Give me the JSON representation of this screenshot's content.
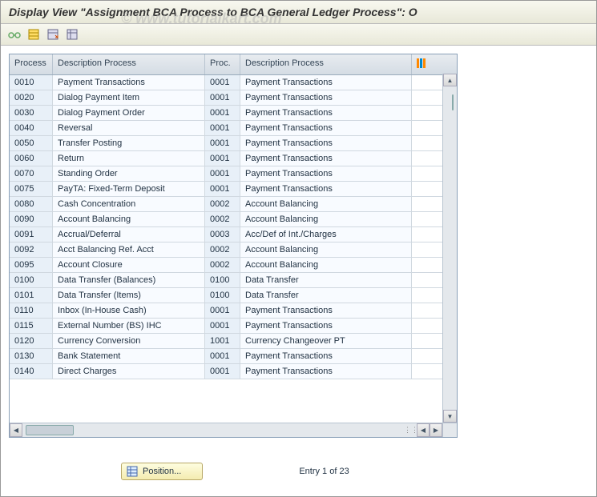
{
  "title": "Display View \"Assignment BCA Process to BCA General Ledger Process\": O",
  "watermark": "© www.tutorialkart.com",
  "toolbar": {
    "icons": [
      "glasses",
      "table-yellow",
      "table-export",
      "table-import"
    ]
  },
  "columns": {
    "process": "Process",
    "desc1": "Description Process",
    "proc": "Proc.",
    "desc2": "Description Process"
  },
  "rows": [
    {
      "process": "0010",
      "desc1": "Payment Transactions",
      "proc": "0001",
      "desc2": "Payment Transactions"
    },
    {
      "process": "0020",
      "desc1": "Dialog Payment Item",
      "proc": "0001",
      "desc2": "Payment Transactions"
    },
    {
      "process": "0030",
      "desc1": "Dialog Payment Order",
      "proc": "0001",
      "desc2": "Payment Transactions"
    },
    {
      "process": "0040",
      "desc1": "Reversal",
      "proc": "0001",
      "desc2": "Payment Transactions"
    },
    {
      "process": "0050",
      "desc1": "Transfer Posting",
      "proc": "0001",
      "desc2": "Payment Transactions"
    },
    {
      "process": "0060",
      "desc1": "Return",
      "proc": "0001",
      "desc2": "Payment Transactions"
    },
    {
      "process": "0070",
      "desc1": "Standing Order",
      "proc": "0001",
      "desc2": "Payment Transactions"
    },
    {
      "process": "0075",
      "desc1": "PayTA: Fixed-Term Deposit",
      "proc": "0001",
      "desc2": "Payment Transactions"
    },
    {
      "process": "0080",
      "desc1": "Cash Concentration",
      "proc": "0002",
      "desc2": "Account Balancing"
    },
    {
      "process": "0090",
      "desc1": "Account Balancing",
      "proc": "0002",
      "desc2": "Account Balancing"
    },
    {
      "process": "0091",
      "desc1": "Accrual/Deferral",
      "proc": "0003",
      "desc2": "Acc/Def of Int./Charges"
    },
    {
      "process": "0092",
      "desc1": "Acct Balancing Ref. Acct",
      "proc": "0002",
      "desc2": "Account Balancing"
    },
    {
      "process": "0095",
      "desc1": "Account Closure",
      "proc": "0002",
      "desc2": "Account Balancing"
    },
    {
      "process": "0100",
      "desc1": "Data Transfer (Balances)",
      "proc": "0100",
      "desc2": "Data Transfer"
    },
    {
      "process": "0101",
      "desc1": "Data Transfer (Items)",
      "proc": "0100",
      "desc2": "Data Transfer"
    },
    {
      "process": "0110",
      "desc1": "Inbox (In-House Cash)",
      "proc": "0001",
      "desc2": "Payment Transactions"
    },
    {
      "process": "0115",
      "desc1": "External Number (BS) IHC",
      "proc": "0001",
      "desc2": "Payment Transactions"
    },
    {
      "process": "0120",
      "desc1": "Currency Conversion",
      "proc": "1001",
      "desc2": "Currency Changeover PT"
    },
    {
      "process": "0130",
      "desc1": "Bank Statement",
      "proc": "0001",
      "desc2": "Payment Transactions"
    },
    {
      "process": "0140",
      "desc1": "Direct Charges",
      "proc": "0001",
      "desc2": "Payment Transactions"
    }
  ],
  "footer": {
    "position_label": "Position...",
    "entry_text": "Entry 1 of 23"
  }
}
